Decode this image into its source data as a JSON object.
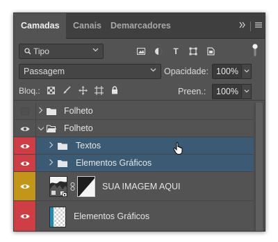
{
  "tabs": [
    {
      "label": "Camadas",
      "active": true
    },
    {
      "label": "Canais",
      "active": false
    },
    {
      "label": "Demarcadores",
      "active": false
    }
  ],
  "tabbar": {
    "overflow_icon": "double-chevron-right-icon",
    "menu_icon": "panel-menu-icon"
  },
  "filter": {
    "kind_label": "Tipo",
    "icons": [
      "pixel-layer-filter-icon",
      "adjustment-layer-filter-icon",
      "type-layer-filter-icon",
      "shape-layer-filter-icon",
      "smart-object-filter-icon"
    ],
    "type_letter": "T"
  },
  "blend": {
    "mode": "Passagem",
    "opacity_label": "Opacidade:",
    "opacity_value": "100%"
  },
  "lock": {
    "label": "Bloq.:",
    "icons": [
      "lock-transparent-pixels-icon",
      "lock-image-pixels-icon",
      "lock-position-icon",
      "lock-artboard-icon",
      "lock-all-icon"
    ],
    "fill_label": "Preen.:",
    "fill_value": "100%"
  },
  "layers": [
    {
      "name": "Folheto",
      "type": "group",
      "visible": false,
      "expanded": false,
      "indent": 0,
      "selected": false
    },
    {
      "name": "Folheto",
      "type": "group",
      "visible": true,
      "expanded": true,
      "indent": 0,
      "selected": false
    },
    {
      "name": "Textos",
      "type": "group",
      "visible": true,
      "expanded": false,
      "indent": 1,
      "selected": true,
      "vis_color": "#cf3d45"
    },
    {
      "name": "Elementos Gráficos",
      "type": "group",
      "visible": true,
      "expanded": false,
      "indent": 1,
      "selected": true,
      "vis_color": "#cf3d45"
    },
    {
      "name": "SUA IMAGEM AQUI",
      "type": "smart-object-with-mask",
      "visible": true,
      "selected": false,
      "vis_color": "#c3961a"
    },
    {
      "name": "Elementos Gráficos",
      "type": "pixel",
      "visible": true,
      "selected": false,
      "vis_color": "#cf3d45"
    }
  ],
  "colors": {
    "panel_bg": "#535353",
    "tabbar_bg": "#3f3f3f",
    "selected_row": "#3b5a73",
    "label_red": "#cf3d45",
    "label_yellow": "#c3961a"
  }
}
